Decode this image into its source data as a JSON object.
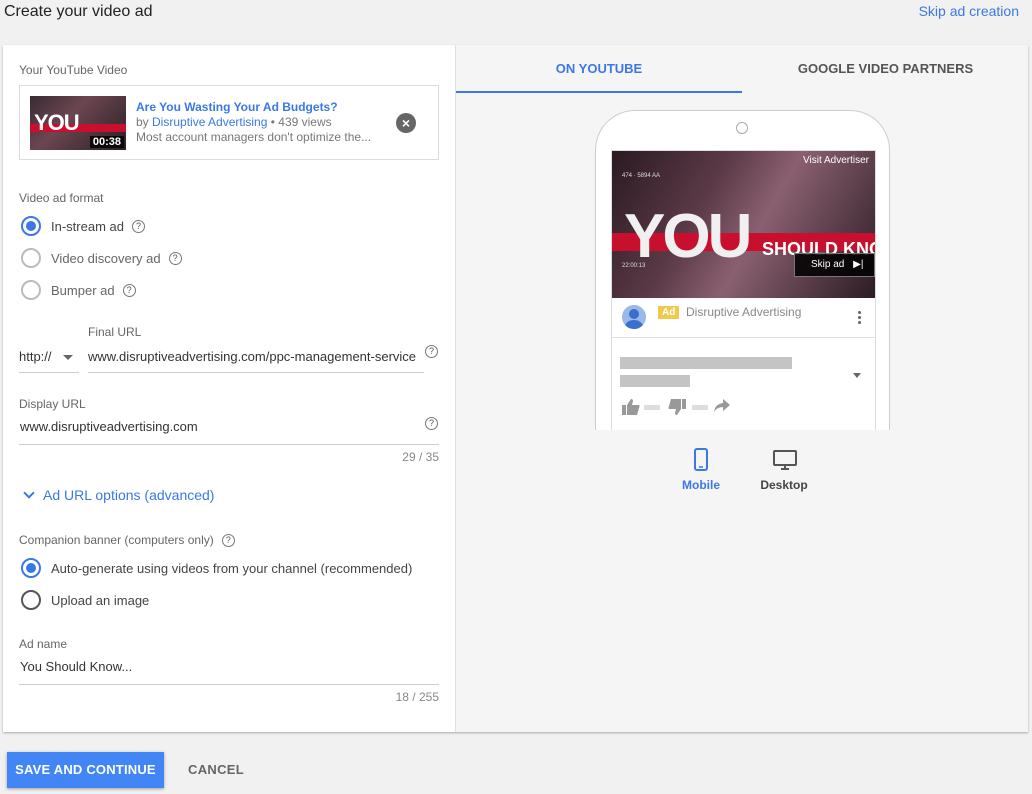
{
  "header": {
    "title": "Create your video ad",
    "skip_label": "Skip ad creation"
  },
  "video": {
    "section_label": "Your YouTube Video",
    "thumb_text": "YOU",
    "duration": "00:38",
    "title": "Are You Wasting Your Ad Budgets?",
    "by_prefix": "by ",
    "channel": "Disruptive Advertising",
    "views": " • 439 views",
    "description": "Most account managers don't optimize the...",
    "close_icon": "close-circle-icon"
  },
  "format": {
    "section_label": "Video ad format",
    "options": [
      {
        "label": "In-stream ad",
        "selected": true
      },
      {
        "label": "Video discovery ad",
        "selected": false
      },
      {
        "label": "Bumper ad",
        "selected": false
      }
    ]
  },
  "final_url": {
    "label": "Final URL",
    "protocol": "http://",
    "value": "www.disruptiveadvertising.com/ppc-management-service"
  },
  "display_url": {
    "label": "Display URL",
    "value": "www.disruptiveadvertising.com",
    "counter": "29 / 35"
  },
  "advanced": {
    "label": "Ad URL options (advanced)"
  },
  "companion": {
    "section_label": "Companion banner (computers only)",
    "options": [
      {
        "label": "Auto-generate using videos from your channel (recommended)",
        "selected": true
      },
      {
        "label": "Upload an image",
        "selected": false
      }
    ]
  },
  "ad_name": {
    "label": "Ad name",
    "value": "You Should Know...",
    "counter": "18 / 255"
  },
  "preview": {
    "tabs": [
      {
        "label": "ON YOUTUBE",
        "active": true
      },
      {
        "label": "GOOGLE VIDEO PARTNERS",
        "active": false
      }
    ],
    "player": {
      "visit_label": "Visit Advertiser",
      "skip_label": "Skip ad",
      "big_word": "YOU",
      "sub_word": "SHOULD KNO",
      "meta_top": "474 · 5894 AA",
      "meta_time": "22:00:13"
    },
    "ad_badge": "Ad",
    "channel": "Disruptive Advertising",
    "devices": [
      {
        "label": "Mobile",
        "active": true,
        "icon": "smartphone-icon"
      },
      {
        "label": "Desktop",
        "active": false,
        "icon": "monitor-icon"
      }
    ],
    "accent_color": "#3b78e7"
  },
  "footer": {
    "save_label": "SAVE AND CONTINUE",
    "cancel_label": "CANCEL"
  }
}
